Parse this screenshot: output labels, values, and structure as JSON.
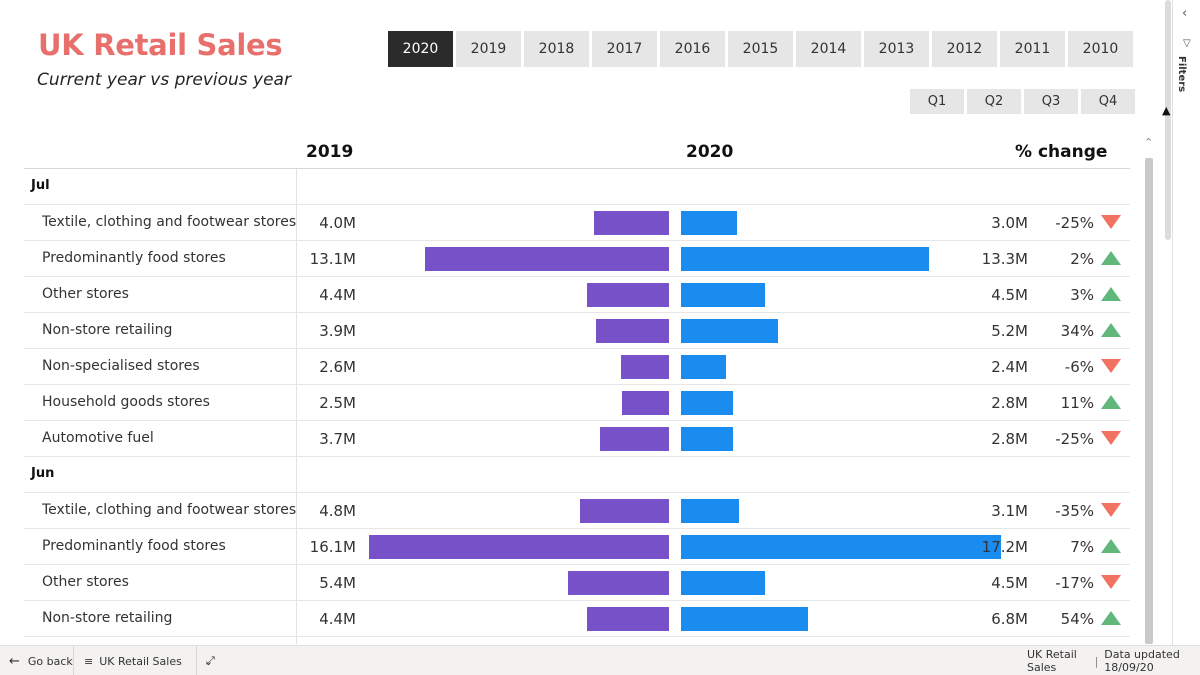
{
  "report": {
    "title": "UK Retail Sales",
    "subtitle": "Current year vs previous year"
  },
  "year_slicer": {
    "options": [
      "2020",
      "2019",
      "2018",
      "2017",
      "2016",
      "2015",
      "2014",
      "2013",
      "2012",
      "2011",
      "2010"
    ],
    "selected": "2020"
  },
  "quarter_slicer": {
    "options": [
      "Q1",
      "Q2",
      "Q3",
      "Q4"
    ]
  },
  "table": {
    "header_prev": "2019",
    "header_curr": "2020",
    "header_change": "% change",
    "groups": [
      {
        "label": "Jul",
        "rows": [
          {
            "category": "Textile, clothing and footwear stores",
            "prev": "4.0M",
            "curr": "3.0M",
            "change": "-25%",
            "direction": "down"
          },
          {
            "category": "Predominantly food stores",
            "prev": "13.1M",
            "curr": "13.3M",
            "change": "2%",
            "direction": "up"
          },
          {
            "category": "Other stores",
            "prev": "4.4M",
            "curr": "4.5M",
            "change": "3%",
            "direction": "up"
          },
          {
            "category": "Non-store retailing",
            "prev": "3.9M",
            "curr": "5.2M",
            "change": "34%",
            "direction": "up"
          },
          {
            "category": "Non-specialised stores",
            "prev": "2.6M",
            "curr": "2.4M",
            "change": "-6%",
            "direction": "down"
          },
          {
            "category": "Household goods stores",
            "prev": "2.5M",
            "curr": "2.8M",
            "change": "11%",
            "direction": "up"
          },
          {
            "category": "Automotive fuel",
            "prev": "3.7M",
            "curr": "2.8M",
            "change": "-25%",
            "direction": "down"
          }
        ]
      },
      {
        "label": "Jun",
        "rows": [
          {
            "category": "Textile, clothing and footwear stores",
            "prev": "4.8M",
            "curr": "3.1M",
            "change": "-35%",
            "direction": "down"
          },
          {
            "category": "Predominantly food stores",
            "prev": "16.1M",
            "curr": "17.2M",
            "change": "7%",
            "direction": "up"
          },
          {
            "category": "Other stores",
            "prev": "5.4M",
            "curr": "4.5M",
            "change": "-17%",
            "direction": "down"
          },
          {
            "category": "Non-store retailing",
            "prev": "4.4M",
            "curr": "6.8M",
            "change": "54%",
            "direction": "up"
          }
        ]
      }
    ]
  },
  "chart_data": {
    "type": "bar",
    "series": [
      {
        "name": "2019",
        "color": "#7651c8"
      },
      {
        "name": "2020",
        "color": "#1a8cf0"
      }
    ],
    "unit": "M",
    "groups": [
      {
        "label": "Jul",
        "categories": [
          "Textile, clothing and footwear stores",
          "Predominantly food stores",
          "Other stores",
          "Non-store retailing",
          "Non-specialised stores",
          "Household goods stores",
          "Automotive fuel"
        ],
        "prev": [
          4.0,
          13.1,
          4.4,
          3.9,
          2.6,
          2.5,
          3.7
        ],
        "curr": [
          3.0,
          13.3,
          4.5,
          5.2,
          2.4,
          2.8,
          2.8
        ]
      },
      {
        "label": "Jun",
        "categories": [
          "Textile, clothing and footwear stores",
          "Predominantly food stores",
          "Other stores",
          "Non-store retailing"
        ],
        "prev": [
          4.8,
          16.1,
          5.4,
          4.4
        ],
        "curr": [
          3.1,
          17.2,
          4.5,
          6.8
        ]
      }
    ],
    "value_max": 16.1
  },
  "colors": {
    "title": "#e8706c",
    "bar_prev": "#7651c8",
    "bar_curr": "#1a8cf0",
    "indicator_down": "#f0725f",
    "indicator_up": "#5fb87a",
    "slicer_selected": "#2b2b2b",
    "slicer_default": "#e6e6e6"
  },
  "filters_pane": {
    "label": "Filters",
    "icon": "funnel-icon"
  },
  "bottom_bar": {
    "back_label": "Go back",
    "page_label": "UK Retail Sales",
    "report_name": "UK Retail Sales",
    "data_updated": "Data updated 18/09/20"
  }
}
